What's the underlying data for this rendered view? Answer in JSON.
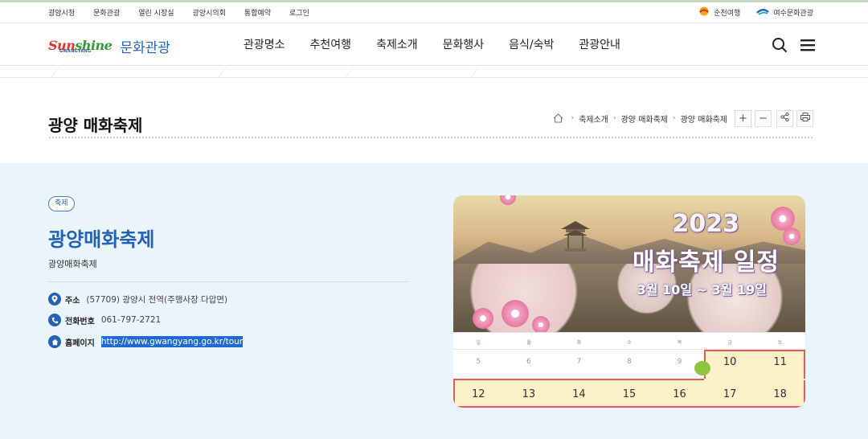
{
  "util_links": [
    "광양시청",
    "문화관광",
    "열린 시장실",
    "광양시의회",
    "통합예약",
    "로그인"
  ],
  "external_links": [
    {
      "label": "순천여행",
      "icon": "suncheon-logo-icon"
    },
    {
      "label": "여수문화관광",
      "icon": "yeosu-logo-icon"
    }
  ],
  "logo": {
    "text_a": "Sun",
    "text_b": "shine",
    "sub": "GWANGYANG",
    "label": "문화관광"
  },
  "gnb": [
    "관광명소",
    "추천여행",
    "축제소개",
    "문화행사",
    "음식/숙박",
    "관광안내"
  ],
  "page_title": "광양 매화축제",
  "breadcrumb": [
    "축제소개",
    "광양 매화축제",
    "광양 매화축제"
  ],
  "tools": {
    "zoom_in": "+",
    "zoom_out": "−"
  },
  "festival": {
    "tag": "축제",
    "title": "광양매화축제",
    "subtitle": "광양매화축제",
    "address_label": "주소",
    "address": "(57709) 광양시 전역(주행사장 다압면)",
    "phone_label": "전화번호",
    "phone": "061-797-2721",
    "homepage_label": "홈페이지",
    "homepage": "http://www.gwangyang.go.kr/tour"
  },
  "poster": {
    "year": "2023",
    "title": "매화축제 일정",
    "dates": "3월 10일 ~ 3월 19일",
    "weekdays": [
      "일",
      "월",
      "화",
      "수",
      "목",
      "금",
      "토"
    ],
    "week1": [
      "5",
      "6",
      "7",
      "8",
      "9",
      "10",
      "11"
    ],
    "week2": [
      "12",
      "13",
      "14",
      "15",
      "16",
      "17",
      "18"
    ]
  },
  "colors": {
    "brand_blue": "#2561b3",
    "highlight": "#fbf1c6",
    "highlight_border": "#e35a5a",
    "content_bg": "#eaf4fb"
  }
}
